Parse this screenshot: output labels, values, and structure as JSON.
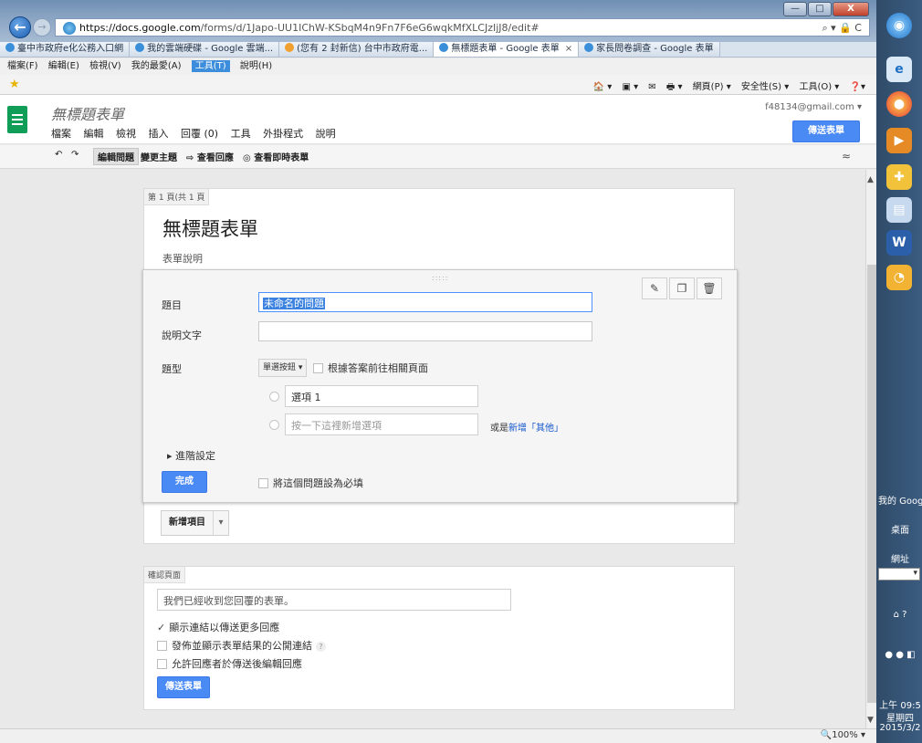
{
  "browser": {
    "url_host": "https://docs.google.com",
    "url_path": "/forms/d/1Japo-UU1IChW-KSbqM4n9Fn7F6eG6wqkMfXLCJzIjJ8/edit#",
    "addr_tools": "⌕ ▾ 🔒 C",
    "window_buttons": [
      "—",
      "□",
      "X"
    ],
    "tabs": [
      {
        "label": "臺中市政府e化公務入口網"
      },
      {
        "label": "我的雲端硬碟 - Google 雲端..."
      },
      {
        "label": "(您有 2 封新信) 台中市政府電..."
      },
      {
        "label": "無標題表單 - Google 表單",
        "close": "×"
      },
      {
        "label": "家長問卷調查 - Google 表單"
      }
    ],
    "menu": [
      "檔案(F)",
      "編輯(E)",
      "檢視(V)",
      "我的最愛(A)",
      "工具(T)",
      "說明(H)"
    ],
    "command_bar": [
      "🏠 ▾",
      "▣ ▾",
      "✉",
      "🖶 ▾",
      "網頁(P) ▾",
      "安全性(S) ▾",
      "工具(O) ▾",
      "❓▾"
    ],
    "zoom": "🔍100%  ▾"
  },
  "forms": {
    "doc_title": "無標題表單",
    "menu": [
      "檔案",
      "編輯",
      "檢視",
      "插入",
      "回覆 (0)",
      "工具",
      "外掛程式",
      "說明"
    ],
    "account": "f48134@gmail.com",
    "send_button": "傳送表單",
    "toolbar": {
      "undo": "↶",
      "redo": "↷",
      "edit_questions": "編輯問題",
      "change_theme": "變更主題",
      "view_responses": "查看回應",
      "view_live": "查看即時表單",
      "collapse": "≈"
    }
  },
  "form": {
    "page_label": "第 1 頁(共 1 頁",
    "title": "無標題表單",
    "description": "表單說明",
    "question": {
      "drag_handle": ":::::",
      "title_label": "題目",
      "title_value": "未命名的問題",
      "help_label": "說明文字",
      "help_value": "",
      "type_label": "題型",
      "type_value": "單選按鈕",
      "go_to_page": "根據答案前往相關頁面",
      "options": [
        "選項 1"
      ],
      "add_option_placeholder": "按一下這裡新增選項",
      "or_text": "或是",
      "add_other": "新增「其他」",
      "advanced": "進階設定",
      "done": "完成",
      "required": "將這個問題設為必填"
    },
    "add_item": "新增項目"
  },
  "confirmation": {
    "label": "確認頁面",
    "message": "我們已經收到您回覆的表單。",
    "options": [
      {
        "label": "顯示連結以傳送更多回應",
        "checked": true
      },
      {
        "label": "發佈並顯示表單結果的公開連結",
        "checked": false,
        "help": "?"
      },
      {
        "label": "允許回應者於傳送後編輯回應",
        "checked": false
      }
    ],
    "send_button": "傳送表單"
  },
  "desktop_sidebar": {
    "label1": "我的 Goog",
    "label2": "桌面",
    "label3": "網址",
    "time": "上午 09:5",
    "weekday": "星期四",
    "date": "2015/3/2"
  }
}
